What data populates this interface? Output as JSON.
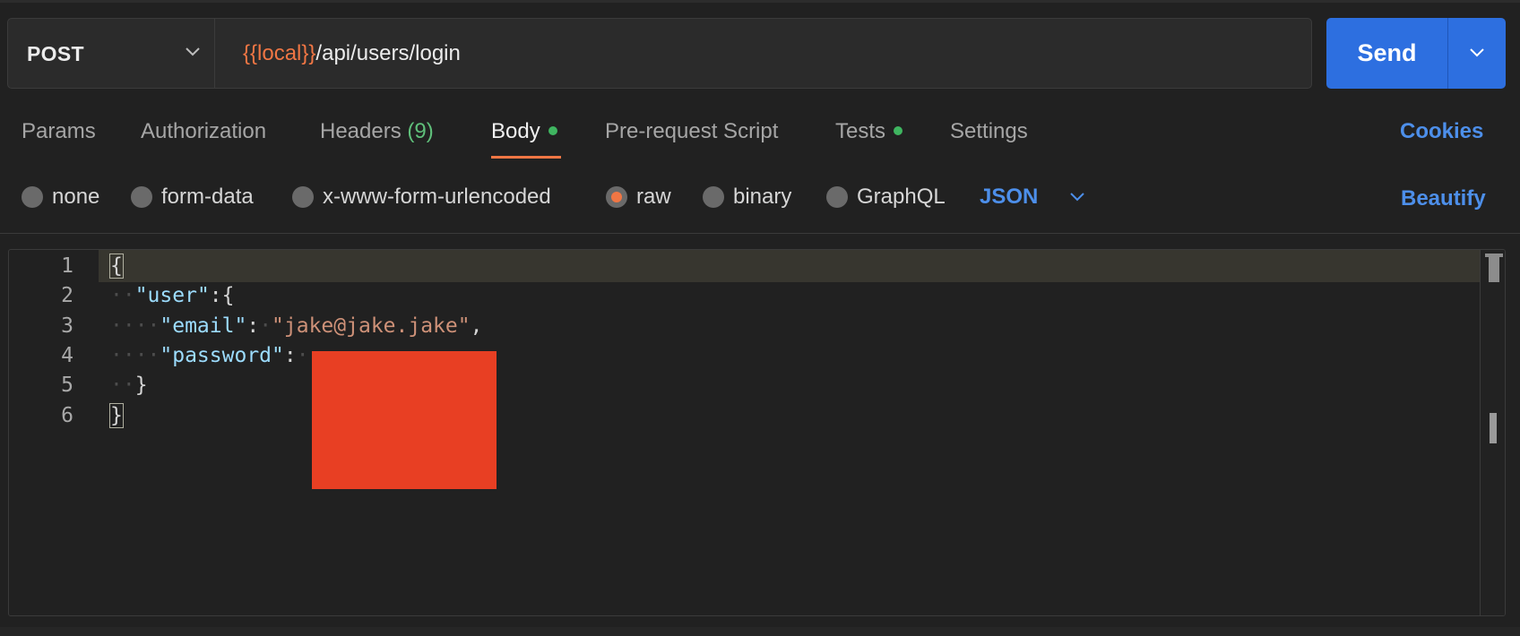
{
  "request": {
    "method": "POST",
    "url_variable": "{{local}}",
    "url_path": "/api/users/login",
    "send_label": "Send"
  },
  "tabs": [
    {
      "label": "Params"
    },
    {
      "label": "Authorization"
    },
    {
      "label": "Headers",
      "count": "(9)"
    },
    {
      "label": "Body",
      "active": true,
      "indicator": true
    },
    {
      "label": "Pre-request Script"
    },
    {
      "label": "Tests",
      "indicator": true
    },
    {
      "label": "Settings"
    }
  ],
  "cookies_label": "Cookies",
  "body_types": [
    {
      "label": "none",
      "selected": false
    },
    {
      "label": "form-data",
      "selected": false
    },
    {
      "label": "x-www-form-urlencoded",
      "selected": false
    },
    {
      "label": "raw",
      "selected": true
    },
    {
      "label": "binary",
      "selected": false
    },
    {
      "label": "GraphQL",
      "selected": false
    }
  ],
  "format_select": "JSON",
  "beautify_label": "Beautify",
  "editor": {
    "line_numbers": [
      "1",
      "2",
      "3",
      "4",
      "5",
      "6"
    ],
    "lines": [
      {
        "indent": "",
        "parts": [
          {
            "t": "{",
            "c": "punc brace-box"
          }
        ]
      },
      {
        "indent": "··",
        "parts": [
          {
            "t": "\"user\"",
            "c": "key"
          },
          {
            "t": ":{",
            "c": "punc"
          }
        ]
      },
      {
        "indent": "····",
        "parts": [
          {
            "t": "\"email\"",
            "c": "key"
          },
          {
            "t": ":",
            "c": "punc"
          },
          {
            "t": "·",
            "c": "ws"
          },
          {
            "t": "\"jake@jake.jake\"",
            "c": "str"
          },
          {
            "t": ",",
            "c": "punc"
          }
        ]
      },
      {
        "indent": "····",
        "parts": [
          {
            "t": "\"password\"",
            "c": "key"
          },
          {
            "t": ":",
            "c": "punc"
          },
          {
            "t": "·",
            "c": "ws"
          }
        ]
      },
      {
        "indent": "··",
        "parts": [
          {
            "t": "}",
            "c": "punc"
          }
        ]
      },
      {
        "indent": "",
        "parts": [
          {
            "t": "}",
            "c": "punc brace-box"
          }
        ]
      }
    ]
  },
  "colors": {
    "accent": "#f07644",
    "primary": "#2d6fe0",
    "link": "#4d8fea",
    "indicator": "#3fb560",
    "redaction": "#e83f23"
  }
}
